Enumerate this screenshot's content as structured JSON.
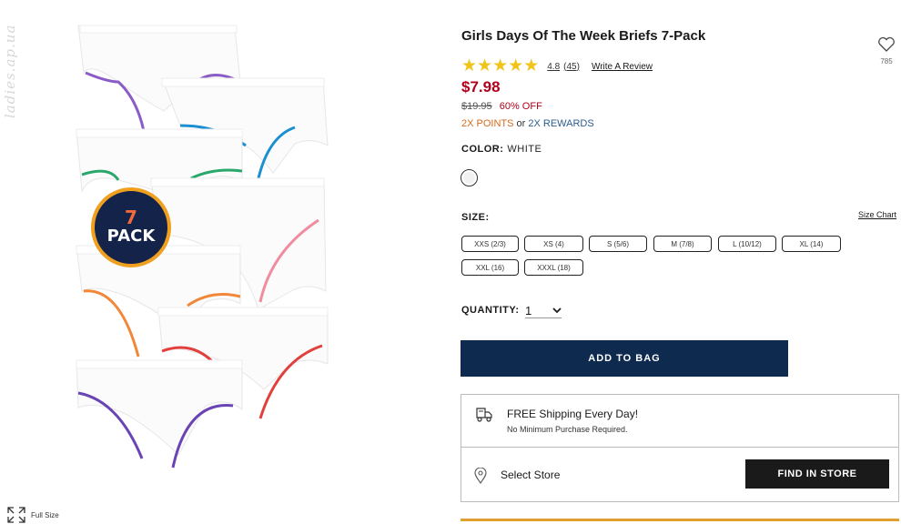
{
  "watermark": "ladies.ap.ua",
  "product": {
    "title": "Girls Days Of The Week Briefs 7-Pack",
    "badge_number": "7",
    "badge_text": "PACK",
    "favorite_count": "785",
    "full_size_label": "Full Size"
  },
  "rating": {
    "stars": 5,
    "value": "4.8",
    "count": "(45)",
    "write_review": "Write A Review",
    "star_color": "#f0c419"
  },
  "pricing": {
    "price": "$7.98",
    "original": "$19.95",
    "discount": "60% OFF",
    "points": "2X POINTS",
    "or": "or",
    "rewards": "2X REWARDS",
    "sale_color": "#b3001b"
  },
  "color": {
    "label": "COLOR:",
    "value": "WHITE"
  },
  "size": {
    "label": "SIZE:",
    "chart_link": "Size Chart",
    "options": [
      "XXS (2/3)",
      "XS (4)",
      "S (5/6)",
      "M (7/8)",
      "L (10/12)",
      "XL (14)",
      "XXL (16)",
      "XXXL (18)"
    ]
  },
  "quantity": {
    "label": "QUANTITY:",
    "value": "1"
  },
  "add_to_bag": "ADD TO BAG",
  "shipping": {
    "title": "FREE Shipping Every Day!",
    "subtitle": "No Minimum Purchase Required."
  },
  "store": {
    "label": "Select Store",
    "button": "FIND IN STORE"
  },
  "colors": {
    "navy": "#0f2a4f",
    "accent": "#e0a030",
    "badge_orange": "#f0a020"
  }
}
